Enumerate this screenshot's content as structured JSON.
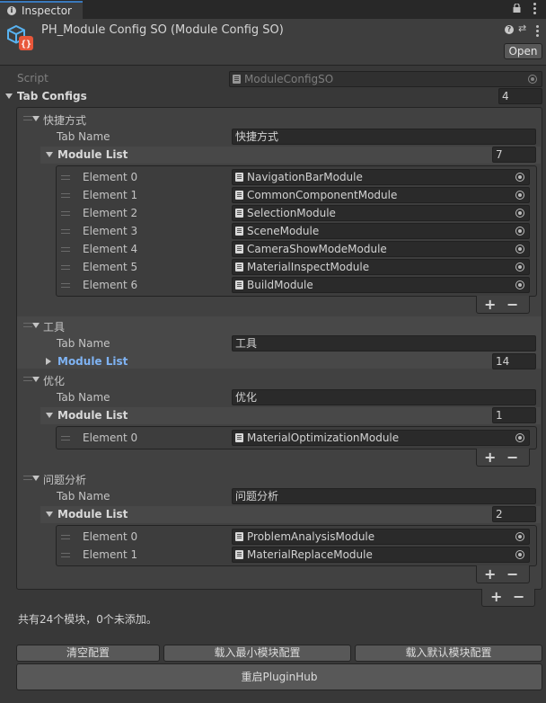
{
  "window": {
    "tab_label": "Inspector"
  },
  "header": {
    "title": "PH_Module Config SO (Module Config SO)",
    "open_label": "Open"
  },
  "script_row": {
    "label": "Script",
    "value": "ModuleConfigSO"
  },
  "tab_configs": {
    "label": "Tab Configs",
    "count": "4"
  },
  "tabs": [
    {
      "title": "快捷方式",
      "tab_name_label": "Tab Name",
      "tab_name_value": "快捷方式",
      "module_list_label": "Module List",
      "module_count": "7",
      "expanded": true,
      "elements": [
        {
          "label": "Element 0",
          "value": "NavigationBarModule"
        },
        {
          "label": "Element 1",
          "value": "CommonComponentModule"
        },
        {
          "label": "Element 2",
          "value": "SelectionModule"
        },
        {
          "label": "Element 3",
          "value": "SceneModule"
        },
        {
          "label": "Element 4",
          "value": "CameraShowModeModule"
        },
        {
          "label": "Element 5",
          "value": "MaterialInspectModule"
        },
        {
          "label": "Element 6",
          "value": "BuildModule"
        }
      ]
    },
    {
      "title": "工具",
      "tab_name_label": "Tab Name",
      "tab_name_value": "工具",
      "module_list_label": "Module List",
      "module_count": "14",
      "expanded": false,
      "elements": []
    },
    {
      "title": "优化",
      "tab_name_label": "Tab Name",
      "tab_name_value": "优化",
      "module_list_label": "Module List",
      "module_count": "1",
      "expanded": true,
      "elements": [
        {
          "label": "Element 0",
          "value": "MaterialOptimizationModule"
        }
      ]
    },
    {
      "title": "问题分析",
      "tab_name_label": "Tab Name",
      "tab_name_value": "问题分析",
      "module_list_label": "Module List",
      "module_count": "2",
      "expanded": true,
      "elements": [
        {
          "label": "Element 0",
          "value": "ProblemAnalysisModule"
        },
        {
          "label": "Element 1",
          "value": "MaterialReplaceModule"
        }
      ]
    }
  ],
  "list_controls": {
    "add": "+",
    "remove": "−"
  },
  "summary": "共有24个模块，0个未添加。",
  "buttons": {
    "clear": "清空配置",
    "load_min": "载入最小模块配置",
    "load_default": "载入默认模块配置",
    "restart": "重启PluginHub"
  },
  "icons": {
    "tab": "info-icon",
    "asset": "scriptable-object-icon",
    "lock": "lock-icon",
    "menu": "kebab-menu-icon",
    "help": "help-icon",
    "preset": "preset-icon",
    "script": "script-file-icon",
    "picker": "object-picker-icon",
    "foldout": "foldout-triangle-icon",
    "drag": "drag-handle-icon"
  },
  "colors": {
    "accent": "#3a79bb",
    "panel": "#383838",
    "field": "#2a2a2a",
    "link": "#7fb3f3"
  }
}
